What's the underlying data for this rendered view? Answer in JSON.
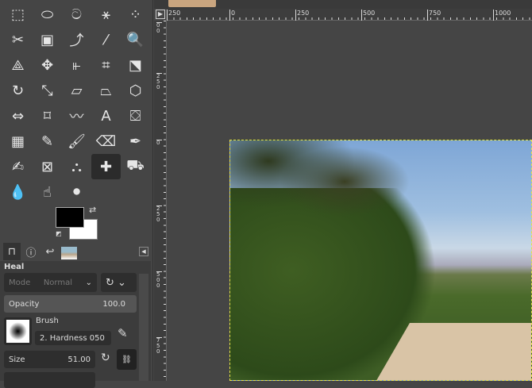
{
  "toolbox": {
    "tools": [
      {
        "name": "rect-select-icon",
        "g": "⬚"
      },
      {
        "name": "ellipse-select-icon",
        "g": "⬭"
      },
      {
        "name": "free-select-icon",
        "g": "ට"
      },
      {
        "name": "fuzzy-select-icon",
        "g": "⚹"
      },
      {
        "name": "color-select-icon",
        "g": "⁘"
      },
      {
        "name": "scissors-icon",
        "g": "✂"
      },
      {
        "name": "foreground-select-icon",
        "g": "▣"
      },
      {
        "name": "paths-icon",
        "g": "⤴"
      },
      {
        "name": "color-picker-icon",
        "g": "⁄"
      },
      {
        "name": "zoom-icon",
        "g": "🔍"
      },
      {
        "name": "measure-icon",
        "g": "⟁"
      },
      {
        "name": "move-icon",
        "g": "✥"
      },
      {
        "name": "align-icon",
        "g": "⫦"
      },
      {
        "name": "crop-icon",
        "g": "⌗"
      },
      {
        "name": "unified-transform-icon",
        "g": "⬔"
      },
      {
        "name": "rotate-icon",
        "g": "↻"
      },
      {
        "name": "scale-icon",
        "g": "⤡"
      },
      {
        "name": "shear-icon",
        "g": "▱"
      },
      {
        "name": "perspective-icon",
        "g": "⏢"
      },
      {
        "name": "3d-transform-icon",
        "g": "⬡"
      },
      {
        "name": "flip-icon",
        "g": "⇔"
      },
      {
        "name": "cage-icon",
        "g": "⌑"
      },
      {
        "name": "warp-icon",
        "g": "〰"
      },
      {
        "name": "text-icon",
        "g": "A"
      },
      {
        "name": "bucket-fill-icon",
        "g": "⛋"
      },
      {
        "name": "gradient-icon",
        "g": "▦"
      },
      {
        "name": "pencil-icon",
        "g": "✎"
      },
      {
        "name": "paintbrush-icon",
        "g": "🖌"
      },
      {
        "name": "eraser-icon",
        "g": "⌫"
      },
      {
        "name": "airbrush-icon",
        "g": "✒"
      },
      {
        "name": "ink-icon",
        "g": "✍"
      },
      {
        "name": "mypaint-brush-icon",
        "g": "⊠"
      },
      {
        "name": "clone-icon",
        "g": "⛬"
      },
      {
        "name": "heal-icon",
        "g": "✚"
      },
      {
        "name": "perspective-clone-icon",
        "g": "⛟"
      },
      {
        "name": "blur-icon",
        "g": "💧"
      },
      {
        "name": "smudge-icon",
        "g": "☝"
      },
      {
        "name": "dodge-burn-icon",
        "g": "⚫"
      }
    ],
    "active_tool": 33
  },
  "colors": {
    "foreground": "#000000",
    "background": "#ffffff",
    "selection": "#e8e048"
  },
  "tool_options": {
    "title": "Heal",
    "mode_label": "Mode",
    "mode_value": "Normal",
    "opacity_label": "Opacity",
    "opacity_value": "100.0",
    "brush_label": "Brush",
    "brush_value": "2. Hardness 050",
    "size_label": "Size",
    "size_value": "51.00"
  },
  "rulers": {
    "horizontal": [
      "250",
      "0",
      "250",
      "500",
      "750",
      "1000"
    ],
    "vertical": [
      "00",
      "250",
      "0",
      "250",
      "500",
      "750"
    ]
  }
}
